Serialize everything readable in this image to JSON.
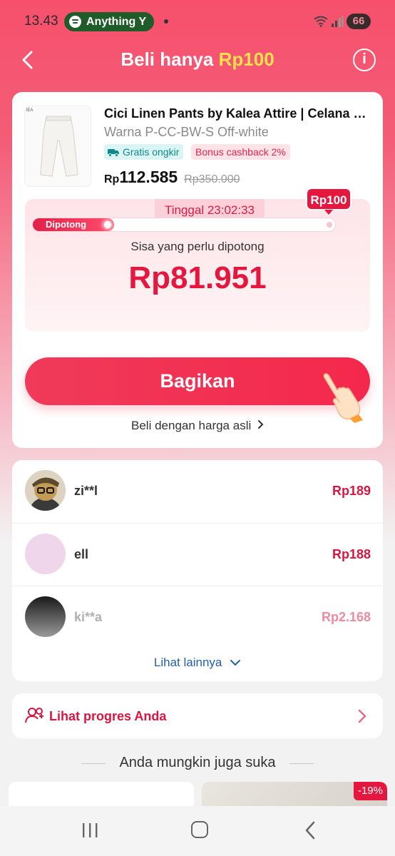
{
  "status_bar": {
    "time": "13.43",
    "music_app_label": "Anything Y",
    "battery": "66"
  },
  "header": {
    "title_prefix": "Beli hanya ",
    "title_accent": "Rp100",
    "info_icon_glyph": "i"
  },
  "product": {
    "title": "Cici Linen Pants by Kalea Attire | Celana Pa...",
    "variant": "Warna P-CC-BW-S Off-white",
    "tag_shipping": "Gratis ongkir",
    "tag_cashback": "Bonus cashback 2%",
    "price_currency": "Rp",
    "price_value": "112.585",
    "price_original": "Rp350.000",
    "image_label": "lEA"
  },
  "cut": {
    "timer": "Tinggal 23:02:33",
    "remaining_label": "Sisa yang perlu dipotong",
    "remaining_amount": "Rp81.951",
    "progress_label": "Dipotong",
    "progress_fraction": 0.27,
    "target_label": "Rp100"
  },
  "actions": {
    "share_label": "Bagikan",
    "buy_original_label": "Beli dengan harga asli"
  },
  "helpers": [
    {
      "name": "zi**l",
      "amount": "Rp189",
      "avatar": "photo"
    },
    {
      "name": "ell",
      "amount": "Rp188",
      "avatar": "pink"
    },
    {
      "name": "ki**a",
      "amount": "Rp2.168",
      "avatar": "gray"
    }
  ],
  "see_more_label": "Lihat lainnya",
  "progress_link_label": "Lihat progres Anda",
  "recommendation": {
    "heading": "Anda mungkin juga suka",
    "discount_badge": "-19%"
  },
  "colors": {
    "brand_red": "#e5173f",
    "header_bg": "#f6506c",
    "accent_yellow": "#ffe14d",
    "link_blue": "#2360a8"
  }
}
